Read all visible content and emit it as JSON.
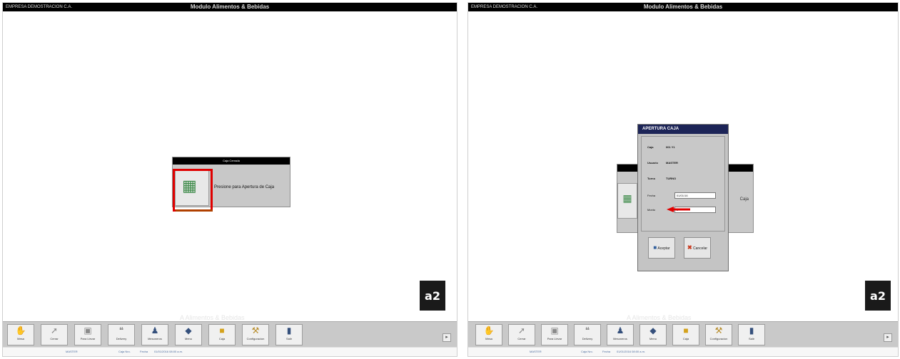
{
  "left_screen": {
    "company": "EMPRESA DEMOSTRACION C.A.",
    "module_title": "Modulo Alimentos & Bebidas",
    "caja_dialog": {
      "caption": "Caja Cerrada",
      "open_label": "Presione para Apertura de Caja"
    },
    "watermark": "A Alimentos & Bebidas",
    "logo": "a2",
    "status": [
      "MASTER",
      "Caja Nro.",
      "Fecha",
      "01/01/2016 08:00 a.m."
    ]
  },
  "right_screen": {
    "bg_dialog_text": "Caja",
    "front_dialog": {
      "caption": "APERTURA CAJA",
      "rows": [
        {
          "k": "Caja",
          "v": "001 Y1"
        },
        {
          "k": "Usuario",
          "v": "MASTER"
        },
        {
          "k": "Turno",
          "v": "TURNO"
        }
      ],
      "fields": [
        {
          "label": "Fecha",
          "value": "01/01/16"
        },
        {
          "label": "Monto",
          "value": "0"
        }
      ],
      "accept_label": "Aceptar",
      "cancel_label": "Cancelar"
    },
    "watermark": "A Alimentos & Bebidas",
    "logo": "a2",
    "status": [
      "MASTER",
      "Caja Nro.",
      "Fecha",
      "01/01/2016 08:00 a.m."
    ]
  },
  "toolbar": [
    {
      "label": "Mesa",
      "icon": "hand-icon"
    },
    {
      "label": "Cerrar",
      "icon": "pointer-icon"
    },
    {
      "label": "Para Llevar",
      "icon": "bag-icon"
    },
    {
      "label": "Delivery",
      "icon": "quote-icon"
    },
    {
      "label": "Mesoneros",
      "icon": "person-icon"
    },
    {
      "label": "Menu",
      "icon": "tag-icon"
    },
    {
      "label": "Caja",
      "icon": "cashbox-icon"
    },
    {
      "label": "Configuracion",
      "icon": "tools-icon"
    },
    {
      "label": "Salir",
      "icon": "door-icon"
    }
  ],
  "colors": {
    "highlight": "#e00000",
    "arrow": "#e00000",
    "dialog_caption": "#1c2457"
  }
}
